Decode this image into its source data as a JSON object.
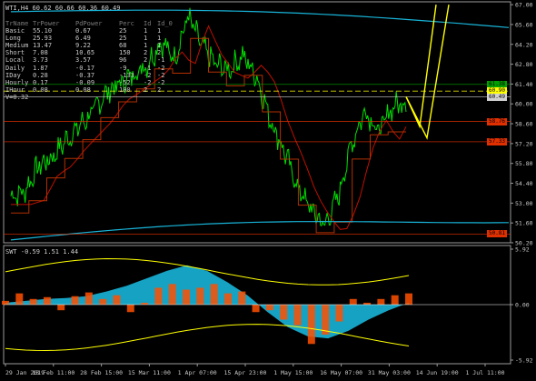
{
  "header": {
    "main_title": "WTI,H4 60.62 60.66 60.36 60.49",
    "sub_title": "SWT -0.59 1.51 1.44"
  },
  "table": {
    "columns": [
      "TrName",
      "TrPower",
      "PdPower",
      "Perc",
      "Id",
      "Id_0"
    ],
    "rows": [
      [
        "Basic",
        "55.10",
        "0.67",
        "25",
        "1",
        "1"
      ],
      [
        "Long",
        "25.93",
        "6.49",
        "25",
        "1",
        "1"
      ],
      [
        "Medium",
        "13.47",
        "9.22",
        "68",
        "1",
        "1"
      ],
      [
        "Short",
        "7.08",
        "10.65",
        "150",
        "2",
        "2"
      ],
      [
        "Local",
        "3.73",
        "3.57",
        "96",
        "2",
        "-1"
      ],
      [
        "Daily",
        "1.87",
        "-0.17",
        "-9",
        "-1",
        "-2"
      ],
      [
        "IDay",
        "0.28",
        "-0.37",
        "-133",
        "-2",
        "-2"
      ],
      [
        "Hourly",
        "0.17",
        "-0.09",
        "-52",
        "-2",
        "-2"
      ],
      [
        "IHour",
        "0.08",
        "0.08",
        "100",
        "2",
        "2"
      ]
    ],
    "footer": "V=0.32"
  },
  "chart_data": [
    {
      "type": "line",
      "title": "WTI,H4",
      "x": [
        "29 Jan 2019",
        "13 Feb 11:00",
        "28 Feb 15:00",
        "15 Mar 11:00",
        "1 Apr 07:00",
        "15 Apr 23:00",
        "1 May 15:00",
        "16 May 07:00",
        "31 May 03:00",
        "14 Jun 19:00",
        "1 Jul 11:00"
      ],
      "y_ticks": [
        "67.00",
        "65.60",
        "64.20",
        "62.80",
        "61.40",
        "60.00",
        "58.60",
        "57.20",
        "55.80",
        "54.40",
        "53.00",
        "51.60",
        "50.20"
      ],
      "ylim": [
        50.2,
        67.2
      ],
      "series": [
        {
          "values": [
            53.5,
            53.8,
            55.6,
            56.2,
            57.4,
            58.4,
            59.4,
            60.8,
            61.4,
            62.1,
            62.8,
            64.4,
            63.2,
            66.2,
            64.1,
            62.8,
            62.4,
            63.4,
            62.0,
            59.0,
            56.8,
            54.2,
            52.6,
            51.4,
            53.4,
            57.2,
            59.6,
            58.0,
            59.8,
            60.2
          ]
        }
      ],
      "price_tags": [
        "61.38",
        "60.90",
        "60.49",
        "58.76",
        "57.33",
        "50.81"
      ],
      "tag_colors": {
        "61.38": "#00a000",
        "60.90": "#ffff00",
        "60.49": "#d0d0d0",
        "58.76": "#e03000",
        "57.33": "#e03000",
        "50.81": "#e03000"
      }
    },
    {
      "type": "area",
      "title": "SWT -0.59 1.51 1.44",
      "y_ticks": [
        "5.92",
        "0.00",
        "-5.92"
      ],
      "ylim": [
        -5.92,
        5.92
      ],
      "x": [
        "29 Jan 2019",
        "13 Feb 11:00",
        "28 Feb 15:00",
        "15 Mar 11:00",
        "1 Apr 07:00",
        "15 Apr 23:00",
        "1 May 15:00",
        "16 May 07:00",
        "31 May 03:00",
        "14 Jun 19:00",
        "1 Jul 11:00"
      ],
      "series": [
        {
          "values": [
            0.2,
            0.4,
            0.6,
            0.7,
            0.9,
            1.4,
            2.0,
            2.8,
            3.6,
            4.2,
            3.6,
            2.4,
            1.0,
            -0.8,
            -2.4,
            -3.4,
            -3.6,
            -2.8,
            -1.6,
            -0.6,
            0.2
          ]
        },
        {
          "values": [
            0.4,
            1.2,
            0.6,
            0.8,
            -0.6,
            0.9,
            1.3,
            0.6,
            1.0,
            -0.8,
            0.2,
            1.8,
            2.2,
            1.6,
            1.8,
            2.2,
            1.2,
            1.4,
            -0.8,
            -0.6,
            -1.6,
            -2.2,
            -4.2,
            -3.2,
            -1.8,
            0.6,
            0.2,
            0.6,
            1.0,
            1.2
          ]
        }
      ]
    }
  ],
  "colors": {
    "price": "#00e000",
    "cyan": "#18b4d8",
    "red": "#c01000",
    "brown": "#b03000",
    "yellow": "#ffff00",
    "orange": "#ff5000"
  }
}
